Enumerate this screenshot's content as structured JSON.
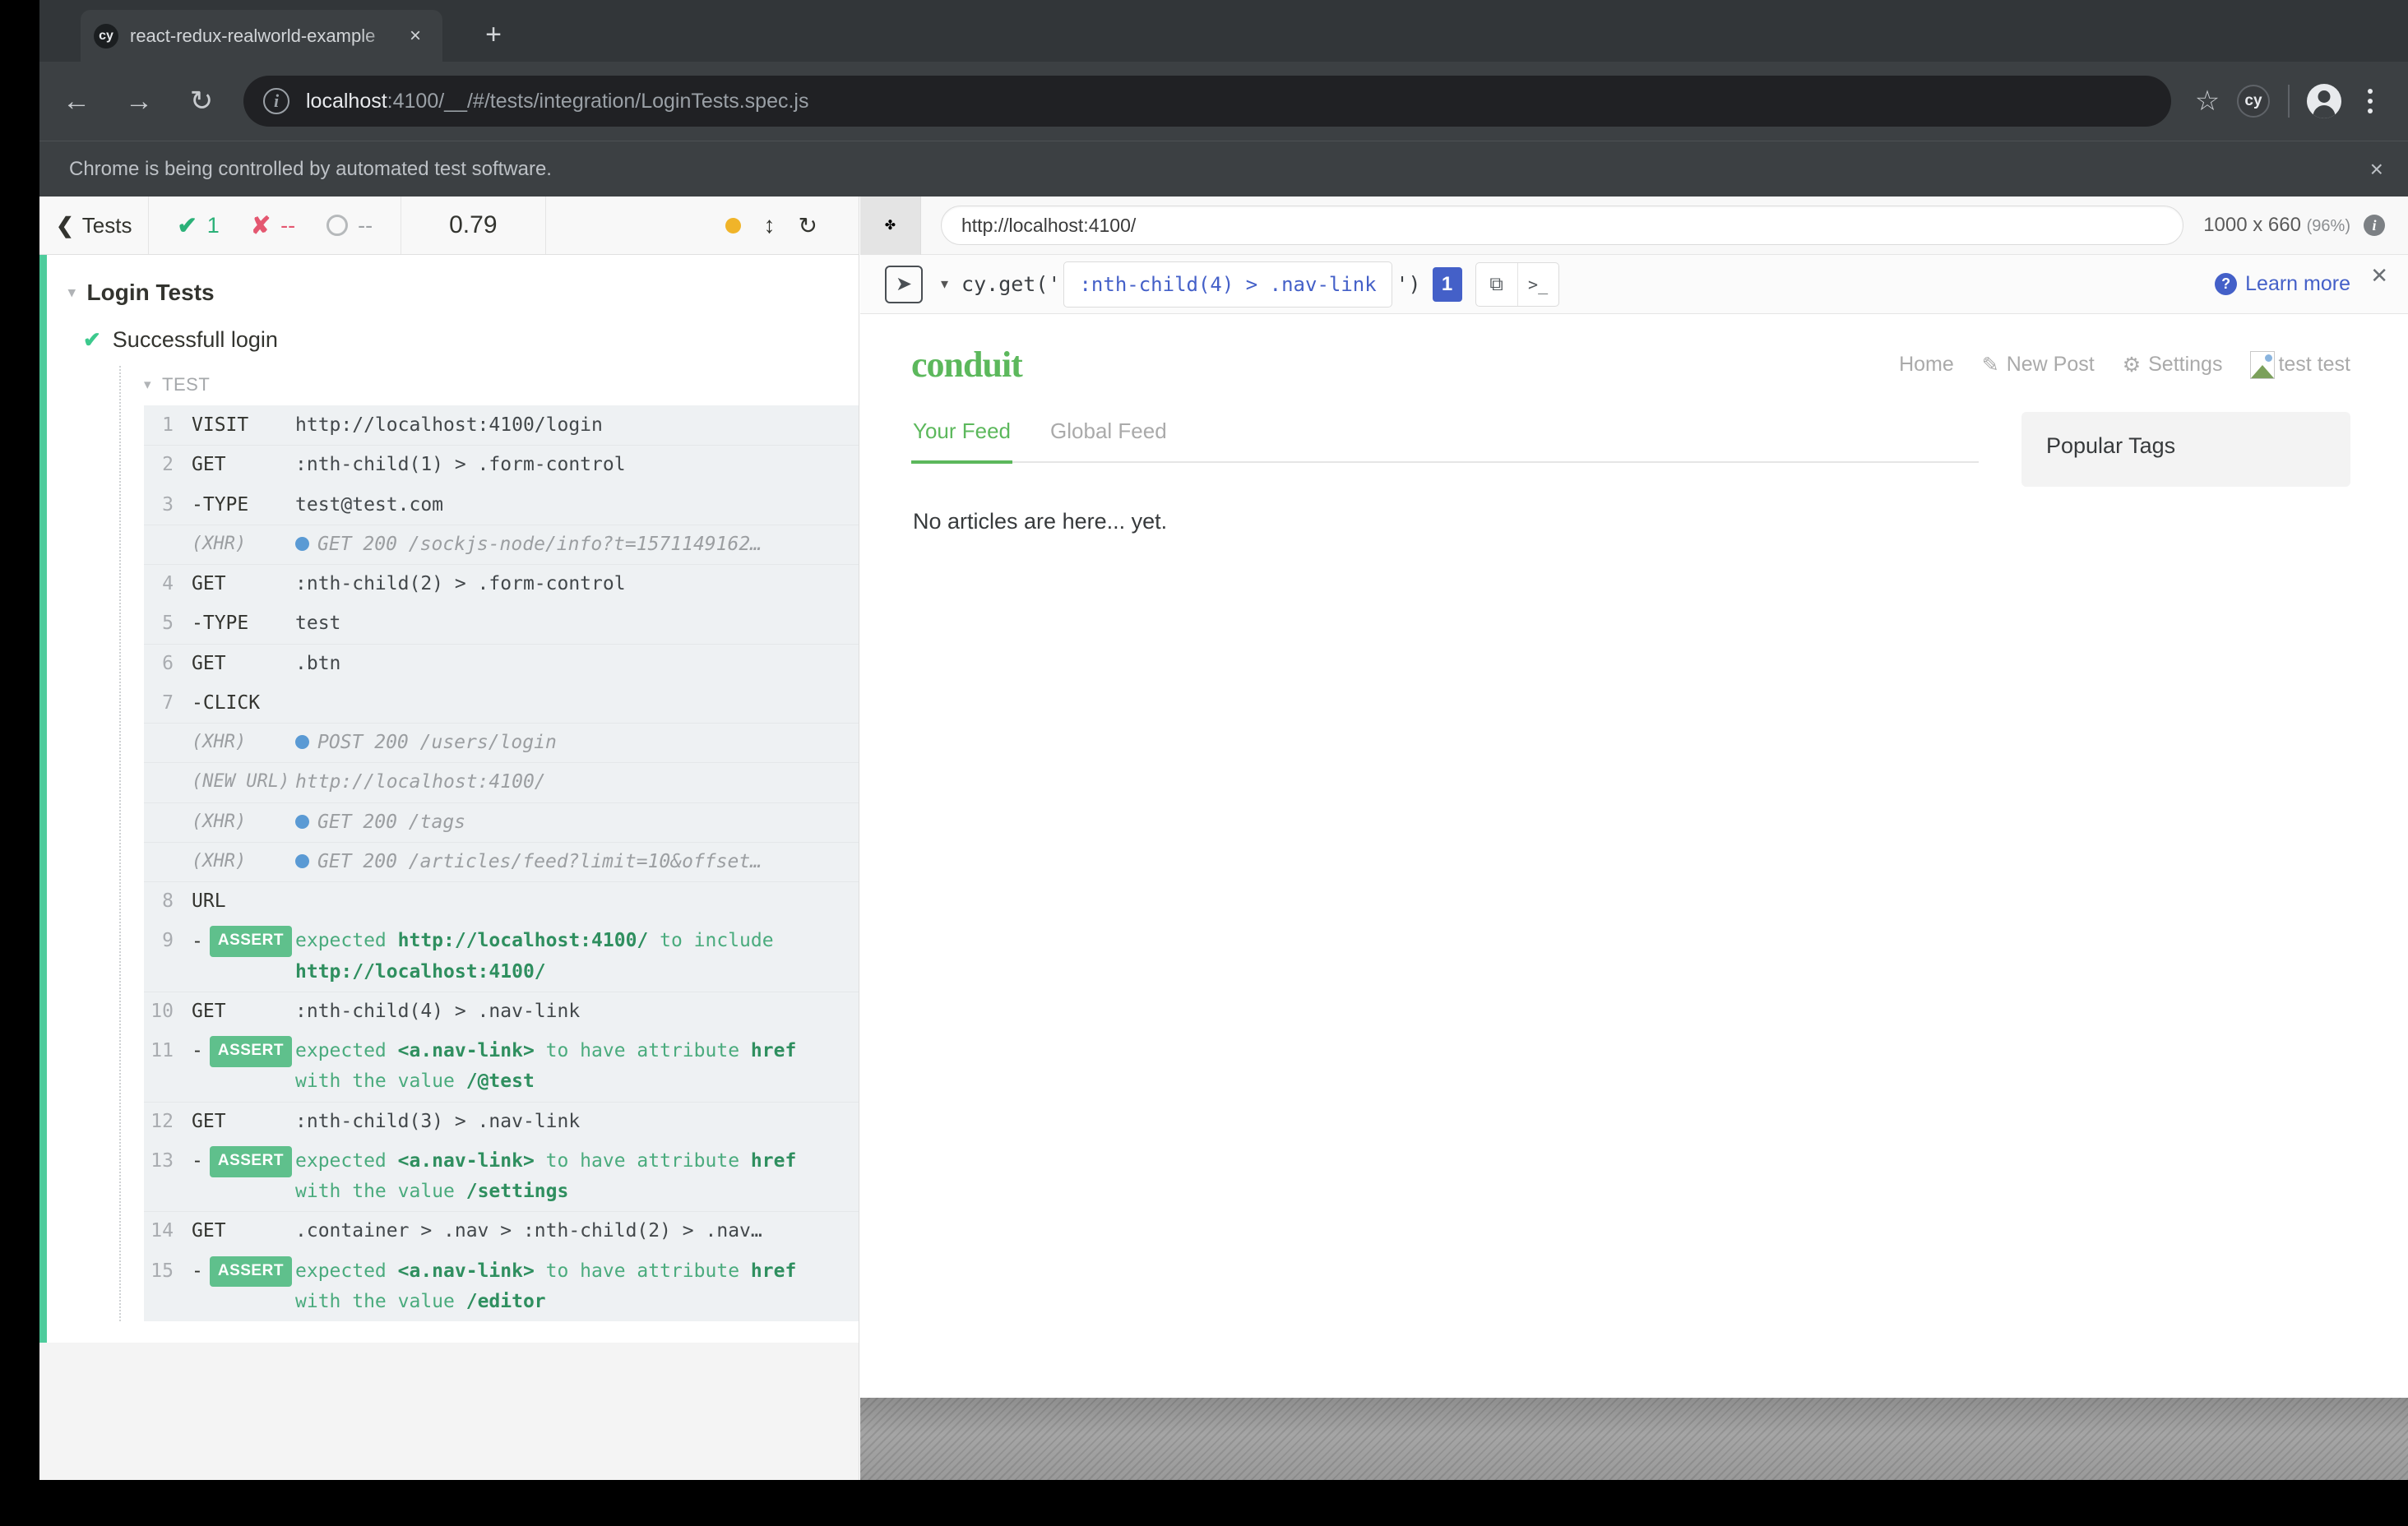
{
  "browser": {
    "tab": {
      "favicon_label": "cy",
      "title": "react-redux-realworld-example",
      "close_icon": "×"
    },
    "new_tab_icon": "+",
    "nav": {
      "back_icon": "←",
      "forward_icon": "→",
      "reload_icon": "↻"
    },
    "omnibox": {
      "info_icon": "i",
      "url_host": "localhost",
      "url_rest": ":4100/__/#/tests/integration/LoginTests.spec.js",
      "star_icon": "☆"
    },
    "toolbar": {
      "extension_label": "cy"
    },
    "infobar": {
      "text": "Chrome is being controlled by automated test software.",
      "close_icon": "×"
    }
  },
  "reporter": {
    "back_label": "Tests",
    "back_icon": "❮",
    "stats": {
      "passed_icon": "✔",
      "passed": "1",
      "failed_icon": "✘",
      "failed": "--",
      "pending": "--"
    },
    "duration": "0.79",
    "controls": {
      "dot": "amber-dot",
      "resize_icon": "↕",
      "restart_icon": "↻"
    },
    "suite": "Login Tests",
    "test": "Successfull login",
    "test_status_icon": "✔",
    "hook_label": "TEST",
    "caret_icon": "▾",
    "commands": [
      {
        "num": "1",
        "name": "VISIT",
        "msg": "http://localhost:4100/login",
        "type": "cmd",
        "alt": true,
        "sep": false
      },
      {
        "num": "2",
        "name": "GET",
        "msg": ":nth-child(1) > .form-control",
        "type": "cmd",
        "alt": true,
        "sep": true
      },
      {
        "num": "3",
        "name": "-TYPE",
        "msg": "test@test.com",
        "type": "cmd",
        "alt": true,
        "sep": false
      },
      {
        "num": "",
        "name": "(XHR)",
        "msg": "GET 200 /sockjs-node/info?t=1571149162…",
        "type": "xhr",
        "alt": true,
        "sep": true
      },
      {
        "num": "4",
        "name": "GET",
        "msg": ":nth-child(2) > .form-control",
        "type": "cmd",
        "alt": true,
        "sep": true
      },
      {
        "num": "5",
        "name": "-TYPE",
        "msg": "test",
        "type": "cmd",
        "alt": true,
        "sep": false
      },
      {
        "num": "6",
        "name": "GET",
        "msg": ".btn",
        "type": "cmd",
        "alt": true,
        "sep": true
      },
      {
        "num": "7",
        "name": "-CLICK",
        "msg": "",
        "type": "cmd",
        "alt": true,
        "sep": false
      },
      {
        "num": "",
        "name": "(XHR)",
        "msg": "POST 200 /users/login",
        "type": "xhr",
        "alt": true,
        "sep": true
      },
      {
        "num": "",
        "name": "(NEW URL)",
        "msg": "http://localhost:4100/",
        "type": "newurl",
        "alt": true,
        "sep": true
      },
      {
        "num": "",
        "name": "(XHR)",
        "msg": "GET 200 /tags",
        "type": "xhr",
        "alt": true,
        "sep": true
      },
      {
        "num": "",
        "name": "(XHR)",
        "msg": "GET 200 /articles/feed?limit=10&offset…",
        "type": "xhr",
        "alt": true,
        "sep": true
      },
      {
        "num": "8",
        "name": "URL",
        "msg": "",
        "type": "cmd",
        "alt": true,
        "sep": true
      },
      {
        "num": "9",
        "name": "ASSERT",
        "msg": "expected |http://localhost:4100/| to include |http://localhost:4100/|",
        "type": "assert",
        "alt": true,
        "sep": false
      },
      {
        "num": "10",
        "name": "GET",
        "msg": ":nth-child(4) > .nav-link",
        "type": "cmd",
        "alt": true,
        "sep": true
      },
      {
        "num": "11",
        "name": "ASSERT",
        "msg": "expected |<a.nav-link>| to have attribute |href| with the value |/@test|",
        "type": "assert",
        "alt": true,
        "sep": false
      },
      {
        "num": "12",
        "name": "GET",
        "msg": ":nth-child(3) > .nav-link",
        "type": "cmd",
        "alt": true,
        "sep": true
      },
      {
        "num": "13",
        "name": "ASSERT",
        "msg": "expected |<a.nav-link>| to have attribute |href| with the value |/settings|",
        "type": "assert",
        "alt": true,
        "sep": false
      },
      {
        "num": "14",
        "name": "GET",
        "msg": ".container > .nav > :nth-child(2) > .nav…",
        "type": "cmd",
        "alt": true,
        "sep": true
      },
      {
        "num": "15",
        "name": "ASSERT",
        "msg": "expected |<a.nav-link>| to have attribute |href| with the value |/editor|",
        "type": "assert",
        "alt": true,
        "sep": false
      }
    ]
  },
  "aut": {
    "move_icon": "✤",
    "url": "http://localhost:4100/",
    "viewport_size": "1000 x 660",
    "viewport_scale": "(96%)",
    "info_icon": "i",
    "playground": {
      "cursor_icon": "➤",
      "caret_icon": "▾",
      "prefix": "cy.get('",
      "selector": ":nth-child(4) > .nav-link",
      "suffix": "')",
      "match_count": "1",
      "copy_icon": "⧉",
      "console_icon": ">_",
      "learn_more": "Learn more",
      "help_icon": "?",
      "close_icon": "✕"
    }
  },
  "app": {
    "brand": "conduit",
    "nav": [
      {
        "label": "Home",
        "icon": ""
      },
      {
        "label": "New Post",
        "icon": "✎"
      },
      {
        "label": "Settings",
        "icon": "⚙"
      },
      {
        "label": "test test",
        "icon": "broken-image"
      }
    ],
    "broken_image_alt": "test",
    "tabs": [
      {
        "label": "Your Feed",
        "active": true
      },
      {
        "label": "Global Feed",
        "active": false
      }
    ],
    "empty_message": "No articles are here... yet.",
    "sidebar_title": "Popular Tags"
  }
}
